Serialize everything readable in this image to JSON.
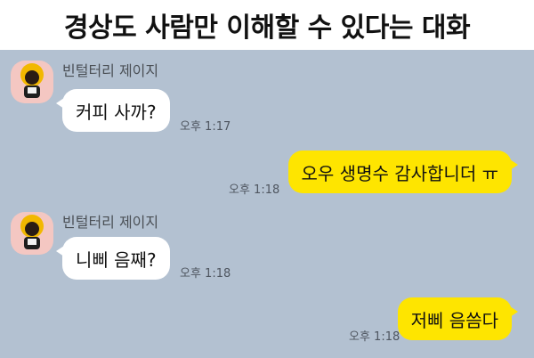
{
  "title": "경상도 사람만 이해할 수 있다는 대화",
  "colors": {
    "chat_background": "#b3c1d1",
    "incoming_bubble": "#ffffff",
    "outgoing_bubble": "#fee500",
    "avatar_background": "#f4c7c2"
  },
  "messages": [
    {
      "direction": "incoming",
      "sender": "빈털터리 제이지",
      "avatar_icon": "jay-z-avatar-icon",
      "text": "커피 사까?",
      "time": "오후 1:17"
    },
    {
      "direction": "outgoing",
      "text": "오우 생명수 감사합니더 ㅠ",
      "time": "오후 1:18"
    },
    {
      "direction": "incoming",
      "sender": "빈털터리 제이지",
      "avatar_icon": "jay-z-avatar-icon",
      "text": "니삐 음째?",
      "time": "오후 1:18"
    },
    {
      "direction": "outgoing",
      "text": "저삐 음씀다",
      "time": "오후 1:18"
    }
  ]
}
